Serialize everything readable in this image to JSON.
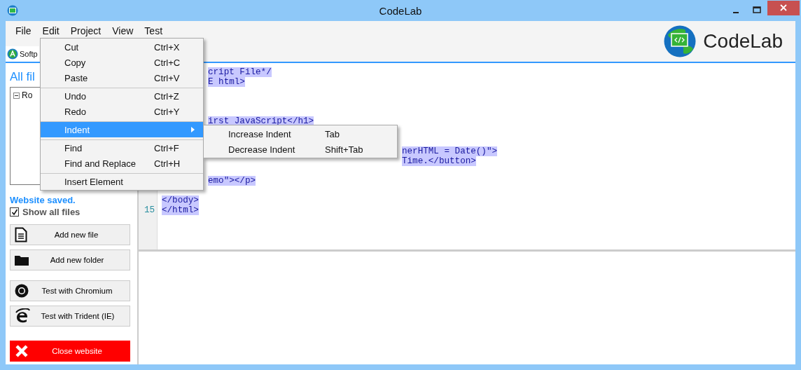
{
  "window": {
    "title": "CodeLab"
  },
  "menu_bar": [
    {
      "label": "File"
    },
    {
      "label": "Edit"
    },
    {
      "label": "Project"
    },
    {
      "label": "View"
    },
    {
      "label": "Test"
    }
  ],
  "logo": {
    "text": "CodeLab"
  },
  "tabs": [
    {
      "label": "Softp"
    }
  ],
  "sidebar": {
    "title": "All fil",
    "tree": [
      {
        "label": "Ro",
        "expanded": true
      }
    ],
    "status": "Website saved.",
    "show_all_files": {
      "label": "Show all files",
      "checked": true
    },
    "buttons": [
      {
        "label": "Add new file",
        "kind": "file"
      },
      {
        "label": "Add new folder",
        "kind": "folder"
      },
      {
        "label": "Test with Chromium",
        "kind": "chromium"
      },
      {
        "label": "Test with Trident (IE)",
        "kind": "ie"
      },
      {
        "label": "Close website",
        "kind": "close"
      }
    ]
  },
  "editor": {
    "lines": [
      {
        "text": "cript File*/",
        "kind": "visible"
      },
      {
        "text": "E html>",
        "kind": "visible"
      },
      {
        "kind": "hidden"
      },
      {
        "kind": "hidden"
      },
      {
        "kind": "hidden"
      },
      {
        "text": "irst JavaScript</h1>",
        "kind": "visible"
      },
      {
        "kind": "hidden"
      },
      {
        "kind": "hidden"
      },
      {
        "text": "nerHTML = Date()\">",
        "kind": "past_submenu"
      },
      {
        "text": "Time.</button>",
        "kind": "past_submenu"
      },
      {
        "kind": "hidden"
      },
      {
        "text": "emo\"></p>",
        "kind": "visible"
      },
      {
        "kind": "hidden"
      },
      {
        "text": "</body>",
        "kind": "visible"
      },
      {
        "number": "15",
        "text": "</html>",
        "kind": "visible"
      }
    ]
  },
  "edit_menu": {
    "items": [
      {
        "label": "Cut",
        "shortcut": "Ctrl+X",
        "selected": false,
        "separator_before": false
      },
      {
        "label": "Copy",
        "shortcut": "Ctrl+C",
        "selected": false,
        "separator_before": false
      },
      {
        "label": "Paste",
        "shortcut": "Ctrl+V",
        "selected": false,
        "separator_before": false
      },
      {
        "label": "Undo",
        "shortcut": "Ctrl+Z",
        "selected": false,
        "separator_before": true
      },
      {
        "label": "Redo",
        "shortcut": "Ctrl+Y",
        "selected": false,
        "separator_before": false
      },
      {
        "label": "Indent",
        "submenu": true,
        "selected": true,
        "separator_before": true
      },
      {
        "label": "Find",
        "shortcut": "Ctrl+F",
        "selected": false,
        "separator_before": true
      },
      {
        "label": "Find and Replace",
        "shortcut": "Ctrl+H",
        "selected": false,
        "separator_before": false
      },
      {
        "label": "Insert Element",
        "selected": false,
        "separator_before": true
      }
    ]
  },
  "indent_submenu": {
    "items": [
      {
        "label": "Increase Indent",
        "shortcut": "Tab"
      },
      {
        "label": "Decrease Indent",
        "shortcut": "Shift+Tab"
      }
    ]
  }
}
